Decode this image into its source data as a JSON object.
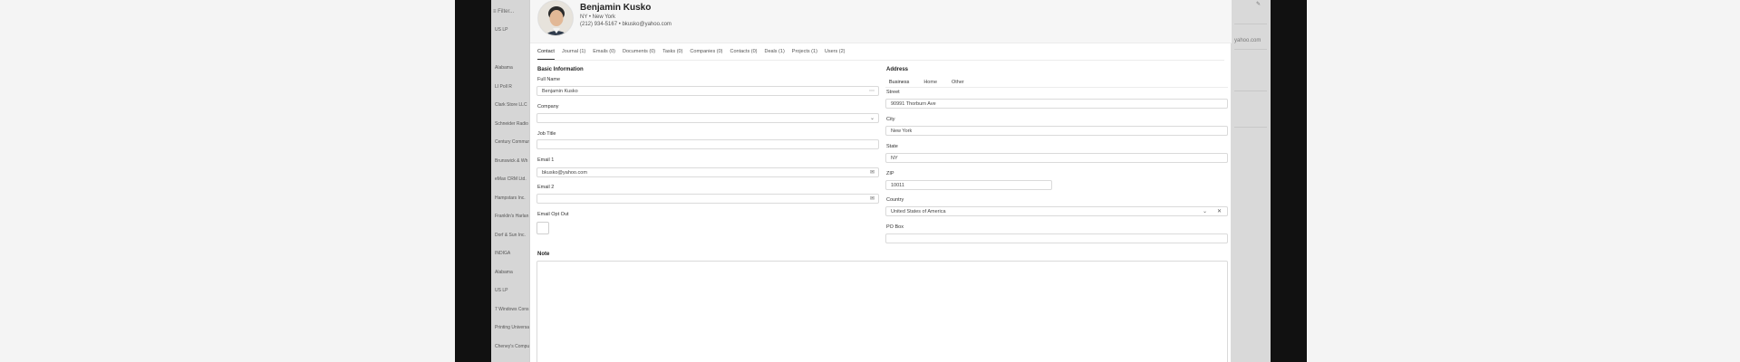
{
  "background": {
    "top_left": "≡ Filter...",
    "list": [
      "US LP",
      "Alabama",
      "LI Poll R",
      "Clark Store LLC",
      "Schneider Radio",
      "Century Communi",
      "Brunswick & Wh",
      "eMax CRM Ltd.",
      "Hampstars Inc.",
      "Franklin's Harlan",
      "Dorf & Sun Inc.",
      "INDIGA",
      "Alabama",
      "US LP",
      "7 Windows Cons",
      "Printing Universal",
      "Cheney's Computer"
    ],
    "right_hint": "yahoo.com"
  },
  "header": {
    "name": "Benjamin Kusko",
    "location": "NY • New York",
    "contact": "(212) 934-5167 • bkusko@yahoo.com"
  },
  "tabs": [
    {
      "label": "Contact",
      "active": true
    },
    {
      "label": "Journal (1)",
      "active": false
    },
    {
      "label": "Emails (0)",
      "active": false
    },
    {
      "label": "Documents (0)",
      "active": false
    },
    {
      "label": "Tasks (0)",
      "active": false
    },
    {
      "label": "Companies (0)",
      "active": false
    },
    {
      "label": "Contacts (0)",
      "active": false
    },
    {
      "label": "Deals (1)",
      "active": false
    },
    {
      "label": "Projects (1)",
      "active": false
    },
    {
      "label": "Users (2)",
      "active": false
    }
  ],
  "basic": {
    "title": "Basic Information",
    "full_name_label": "Full Name",
    "full_name_value": "Benjamin Kusko",
    "company_label": "Company",
    "company_value": "",
    "job_title_label": "Job Title",
    "job_title_value": "",
    "email1_label": "Email 1",
    "email1_value": "bkusko@yahoo.com",
    "email2_label": "Email 2",
    "email2_value": "",
    "opt_out_label": "Email Opt Out"
  },
  "address": {
    "title": "Address",
    "subtabs": [
      {
        "label": "Business",
        "active": true
      },
      {
        "label": "Home",
        "active": false
      },
      {
        "label": "Other",
        "active": false
      }
    ],
    "street_label": "Street",
    "street_value": "90991 Thorburn Ave",
    "city_label": "City",
    "city_value": "New York",
    "state_label": "State",
    "state_value": "NY",
    "zip_label": "ZIP",
    "zip_value": "10011",
    "country_label": "Country",
    "country_value": "United States of America",
    "po_box_label": "PO Box",
    "po_box_value": ""
  },
  "note": {
    "label": "Note"
  }
}
